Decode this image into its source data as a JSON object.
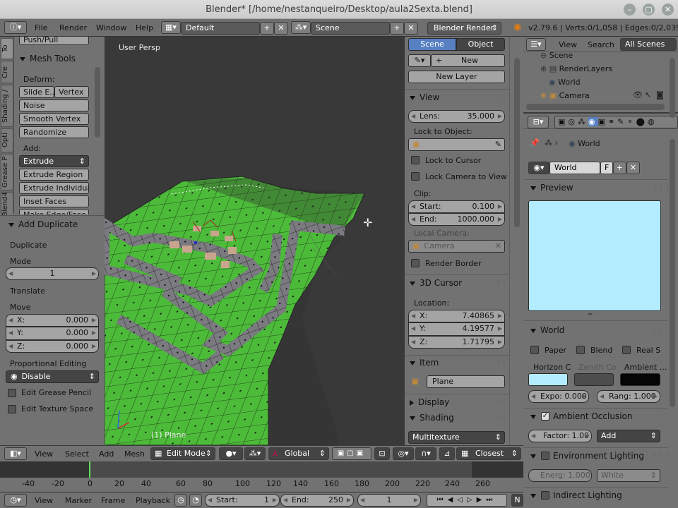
{
  "window": {
    "title": "Blender* [/home/nestanqueiro/Desktop/aula2Sexta.blend]",
    "controls": [
      "–",
      "▢",
      "✕"
    ]
  },
  "info": {
    "menus": [
      "File",
      "Render",
      "Window",
      "Help"
    ],
    "layout": "Default",
    "scene": "Scene",
    "engine": "Blender Render",
    "stats": "v2.79.6 | Verts:0/1,058 | Edges:0/2,039 | Fa"
  },
  "toolshelf": {
    "tabs": [
      "To",
      "Cre",
      "Shading /",
      "Opti",
      "Grease P",
      "Blend4"
    ],
    "push_pull": "Push/Pull",
    "mesh_tools": "Mesh Tools",
    "deform_label": "Deform:",
    "deform_buttons": [
      "Slide E...",
      "Vertex",
      "Noise",
      "Smooth Vertex",
      "Randomize"
    ],
    "add_label": "Add:",
    "extrude": "Extrude",
    "add_buttons": [
      "Extrude Region",
      "Extrude Individual",
      "Inset Faces",
      "Make Edge/Face"
    ]
  },
  "operator": {
    "title": "Add Duplicate",
    "duplicate": "Duplicate",
    "mode_label": "Mode",
    "mode_value": "1",
    "translate": "Translate",
    "move": "Move",
    "x": {
      "k": "X:",
      "v": "0.000"
    },
    "y": {
      "k": "Y:",
      "v": "0.000"
    },
    "z": {
      "k": "Z:",
      "v": "0.000"
    },
    "prop_editing": "Proportional Editing",
    "prop_value": "Disable",
    "grease": "Edit Grease Pencil",
    "texture": "Edit Texture Space"
  },
  "viewport": {
    "label": "User Persp",
    "object": "(1) Plane"
  },
  "npanel": {
    "tab_scene": "Scene",
    "tab_object": "Object",
    "new": "New",
    "new_layer": "New Layer",
    "view": "View",
    "lens_k": "Lens:",
    "lens_v": "35.000",
    "lock_object": "Lock to Object:",
    "lock_cursor": "Lock to Cursor",
    "lock_camera": "Lock Camera to View",
    "clip": "Clip:",
    "start_k": "Start:",
    "start_v": "0.100",
    "end_k": "End:",
    "end_v": "1000.000",
    "local_camera": "Local Camera:",
    "camera": "Camera",
    "render_border": "Render Border",
    "cursor3d": "3D Cursor",
    "location": "Location:",
    "cx_k": "X:",
    "cx_v": "7.40865",
    "cy_k": "Y:",
    "cy_v": "4.19577",
    "cz_k": "Z:",
    "cz_v": "1.71795",
    "item": "Item",
    "item_name": "Plane",
    "display": "Display",
    "shading": "Shading",
    "shading_value": "Multitexture"
  },
  "outliner": {
    "view": "View",
    "search": "Search",
    "filter": "All Scenes",
    "items": [
      "Scene",
      "RenderLayers",
      "World",
      "Camera"
    ]
  },
  "properties": {
    "breadcrumb": "World",
    "world_name": "World",
    "fake": "F",
    "preview": "Preview",
    "world_panel": "World",
    "paper": "Paper",
    "blend": "Blend",
    "real": "Real S",
    "horizon": "Horizon C",
    "zenith": "Zenith Co",
    "ambient": "Ambient ...",
    "expo": "Expo: 0.000",
    "rang": "Rang: 1.000",
    "ao": "Ambient Occlusion",
    "factor": "Factor: 1.00",
    "add": "Add",
    "env": "Environment Lighting",
    "energy": "Energ: 1.000",
    "white": "White",
    "indirect": "Indirect Lighting",
    "colors": {
      "preview": "#b3ecff",
      "horizon": "#b3ecff",
      "zenith": "#4d4d4d",
      "ambient": "#050505"
    }
  },
  "header3d": {
    "menus": [
      "View",
      "Select",
      "Add",
      "Mesh"
    ],
    "mode": "Edit Mode",
    "orientation": "Global",
    "snap": "Closest"
  },
  "timeline": {
    "ticks": [
      "-40",
      "-20",
      "0",
      "20",
      "40",
      "60",
      "80",
      "100",
      "120",
      "140",
      "160",
      "180",
      "200",
      "220",
      "240",
      "260"
    ],
    "menus": [
      "View",
      "Marker",
      "Frame",
      "Playback"
    ],
    "start": "Start:",
    "start_v": "1",
    "end": "End:",
    "end_v": "250",
    "current": "1",
    "cut": "N"
  }
}
